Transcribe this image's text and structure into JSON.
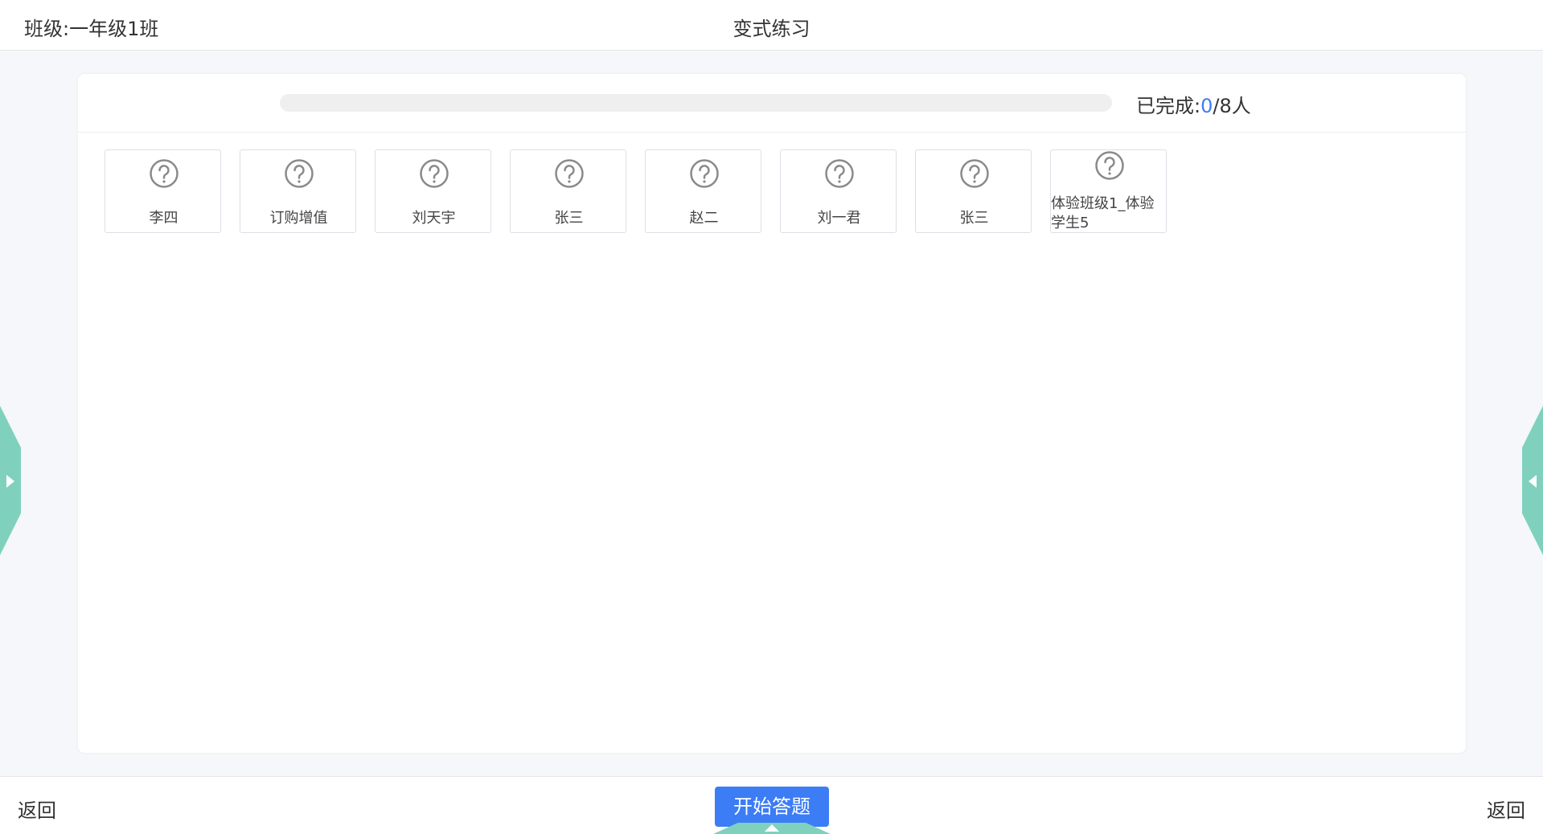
{
  "header": {
    "class_label": "班级:一年级1班",
    "title": "变式练习"
  },
  "progress": {
    "label_prefix": "已完成:",
    "completed": "0",
    "total_suffix": "/8人",
    "fraction": 0
  },
  "students": [
    {
      "name": "李四",
      "icon": "question-circle-icon"
    },
    {
      "name": "订购增值",
      "icon": "question-circle-icon"
    },
    {
      "name": "刘天宇",
      "icon": "question-circle-icon"
    },
    {
      "name": "张三",
      "icon": "question-circle-icon"
    },
    {
      "name": "赵二",
      "icon": "question-circle-icon"
    },
    {
      "name": "刘一君",
      "icon": "question-circle-icon"
    },
    {
      "name": "张三",
      "icon": "question-circle-icon"
    },
    {
      "name": "体验班级1_体验学生5",
      "icon": "question-circle-icon"
    }
  ],
  "footer": {
    "back_left": "返回",
    "start_button": "开始答题",
    "back_right": "返回"
  },
  "colors": {
    "accent": "#3c7cf5",
    "tab": "#7fd1bd",
    "background": "#f5f7fa"
  }
}
